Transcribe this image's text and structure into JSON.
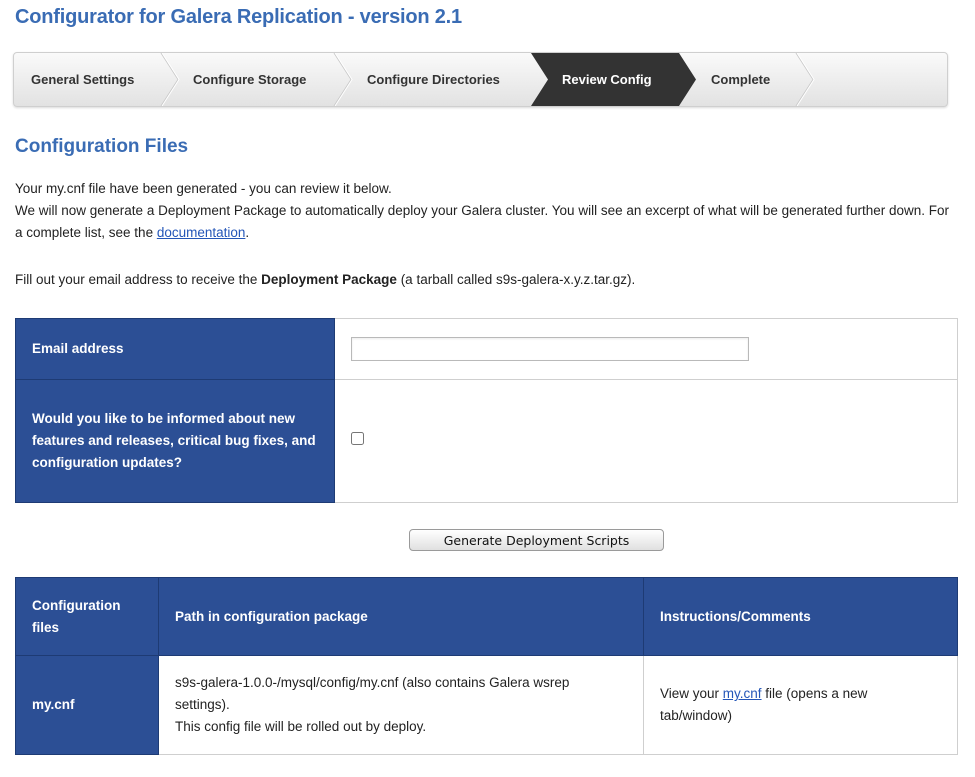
{
  "app": {
    "title": "Configurator for Galera Replication - version 2.1"
  },
  "wizard": {
    "steps": [
      {
        "label": "General Settings",
        "active": false
      },
      {
        "label": "Configure Storage",
        "active": false
      },
      {
        "label": "Configure Directories",
        "active": false
      },
      {
        "label": "Review Config",
        "active": true
      },
      {
        "label": "Complete",
        "active": false
      }
    ]
  },
  "main": {
    "section_title": "Configuration Files",
    "intro_line1": "Your my.cnf file have been generated - you can review it below.",
    "intro_line2_pre": "We will now generate a Deployment Package to automatically deploy your Galera cluster. You will see an excerpt of what will be generated further down. For a complete list, see the ",
    "intro_link": "documentation",
    "intro_line2_post": ".",
    "fill_pre": "Fill out your email address to receive the ",
    "fill_bold": "Deployment Package",
    "fill_post": " (a tarball called s9s-galera-x.y.z.tar.gz)."
  },
  "form": {
    "email_label": "Email address",
    "email_value": "",
    "email_placeholder": "",
    "inform_label": "Would you like to be informed about new features and releases, critical bug fixes, and configuration updates?",
    "inform_checked": false
  },
  "generate_button": "Generate Deployment Scripts",
  "files_table": {
    "headers": [
      "Configuration files",
      "Path in configuration package",
      "Instructions/Comments"
    ],
    "rows": [
      {
        "name": "my.cnf",
        "path_line1": "s9s-galera-1.0.0-/mysql/config/my.cnf (also contains Galera wsrep settings).",
        "path_line2": "This config file will be rolled out by deploy.",
        "instr_pre": "View your ",
        "instr_link": "my.cnf",
        "instr_post": " file (opens a new tab/window)"
      }
    ]
  },
  "colors": {
    "title_blue": "#3a6cb4",
    "header_blue": "#2c4f95",
    "active_step": "#333333",
    "link": "#2456b8"
  }
}
